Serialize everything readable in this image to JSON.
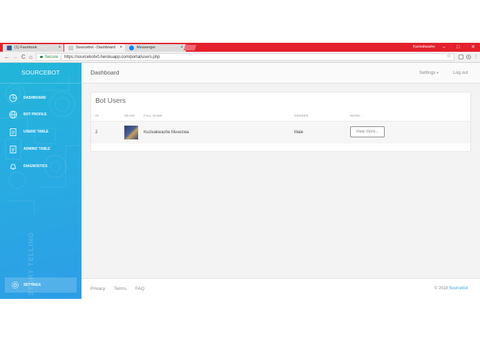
{
  "browser": {
    "tabs": [
      {
        "label": "(1) Facebook",
        "favicon_color": "#3b5998",
        "active": false
      },
      {
        "label": "Sourcebot - Dashboard",
        "favicon_color": "#cfcfcf",
        "active": true
      },
      {
        "label": "Messenger",
        "favicon_color": "#0084ff",
        "active": false
      }
    ],
    "close_glyph": "×",
    "profile_name": "Kuzivakwashe",
    "window_controls": {
      "minimize": "–",
      "maximize": "□",
      "close": "✕"
    },
    "nav": {
      "back": "←",
      "forward": "→",
      "reload": "C",
      "home": "⌂"
    },
    "secure_label": "Secure",
    "url": "https://sourcebotv0.herokuapp.com/portal/users.php",
    "star_icon": "☆",
    "menu_glyph": "⋮",
    "colors": {
      "chrome_red": "#e3202c",
      "secure_green": "#1e8e3e"
    }
  },
  "sidebar": {
    "brand": "SOURCEBOT",
    "items": [
      {
        "label": "DASHBOARD",
        "icon": "pie-chart-icon"
      },
      {
        "label": "BOT PROFILE",
        "icon": "globe-icon"
      },
      {
        "label": "USERS' TABLE",
        "icon": "clipboard-icon"
      },
      {
        "label": "ADMINS' TABLE",
        "icon": "clipboard-icon"
      },
      {
        "label": "DIAGNOSTICS",
        "icon": "bell-icon"
      }
    ],
    "settings_label": "SETTINGS",
    "watermark": "STORY TELLING",
    "colors": {
      "gradient_top": "#22b6d9",
      "gradient_bottom": "#2d9ee6"
    }
  },
  "header": {
    "title": "Dashboard",
    "settings": "Settings",
    "caret": "▾",
    "logout": "Log out"
  },
  "card": {
    "title": "Bot Users",
    "columns": [
      "ID",
      "IMAGE",
      "FULL NAME",
      "GENDER",
      "MORE..."
    ],
    "rows": [
      {
        "id": "2",
        "full_name": "Kuzivakwashe Muvezwa",
        "gender": "Male",
        "action": "View more..."
      }
    ]
  },
  "footer": {
    "links": [
      "Privacy",
      "Terms",
      "FAQ"
    ],
    "copyright_prefix": "© 2018",
    "brand": "Sourcebot",
    "brand_color": "#2aa9e0"
  }
}
